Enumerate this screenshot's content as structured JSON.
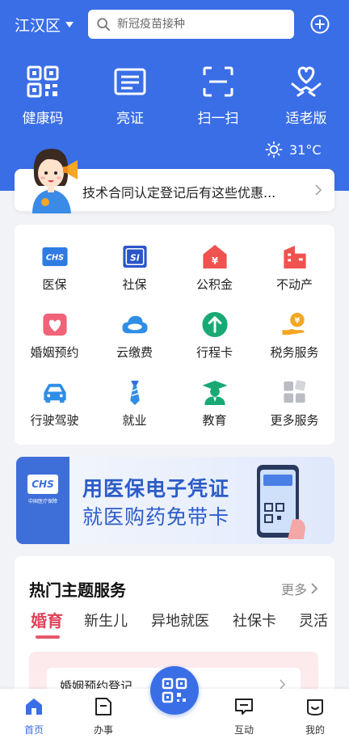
{
  "header": {
    "city": "江汉区",
    "search_placeholder": "新冠疫苗接种",
    "quick_actions": [
      {
        "label": "健康码",
        "icon": "qrcode-icon"
      },
      {
        "label": "亮证",
        "icon": "id-card-icon"
      },
      {
        "label": "扫一扫",
        "icon": "scan-icon"
      },
      {
        "label": "适老版",
        "icon": "elderly-heart-icon"
      }
    ],
    "weather": "31°C"
  },
  "notice": {
    "text": "技术合同认定登记后有这些优惠..."
  },
  "services": [
    {
      "label": "医保",
      "icon": "chs-medical-insurance-icon"
    },
    {
      "label": "社保",
      "icon": "social-security-icon"
    },
    {
      "label": "公积金",
      "icon": "housing-fund-icon"
    },
    {
      "label": "不动产",
      "icon": "real-estate-icon"
    },
    {
      "label": "婚姻预约",
      "icon": "marriage-icon"
    },
    {
      "label": "云缴费",
      "icon": "cloud-payment-icon"
    },
    {
      "label": "行程卡",
      "icon": "trip-card-icon"
    },
    {
      "label": "税务服务",
      "icon": "tax-icon"
    },
    {
      "label": "行驶驾驶",
      "icon": "car-icon"
    },
    {
      "label": "就业",
      "icon": "employment-tie-icon"
    },
    {
      "label": "教育",
      "icon": "education-icon"
    },
    {
      "label": "更多服务",
      "icon": "more-grid-icon"
    }
  ],
  "banner": {
    "logo_text": "CHS",
    "logo_sub": "中国医疗保障",
    "line1": "用医保电子凭证",
    "line2": "就医购药免带卡"
  },
  "topics": {
    "title": "热门主题服务",
    "more": "更多",
    "tabs": [
      "婚育",
      "新生儿",
      "异地就医",
      "社保卡",
      "灵活"
    ],
    "active_tab": "婚育",
    "card_item": "婚姻预约登记"
  },
  "bottom_nav": [
    {
      "label": "首页",
      "icon": "home-icon",
      "active": true
    },
    {
      "label": "办事",
      "icon": "document-icon",
      "active": false
    },
    {
      "label": "互动",
      "icon": "chat-icon",
      "active": false
    },
    {
      "label": "我的",
      "icon": "profile-icon",
      "active": false
    }
  ],
  "colors": {
    "primary": "#3a6ee6",
    "accent_red": "#e0425a"
  }
}
